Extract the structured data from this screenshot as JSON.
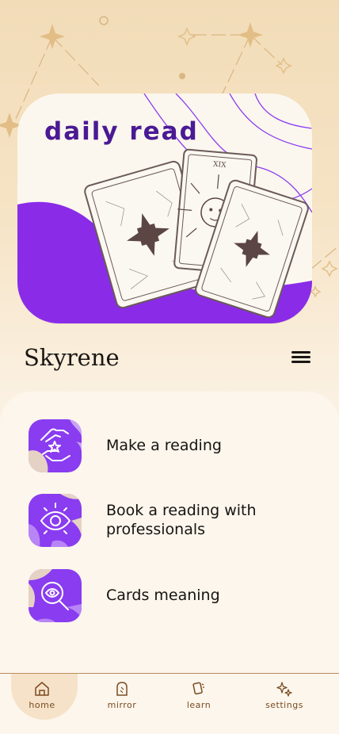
{
  "hero": {
    "title": "daily read"
  },
  "header": {
    "brand": "Skyrene"
  },
  "actions": [
    {
      "label": "Make a reading"
    },
    {
      "label": "Book a reading with professionals"
    },
    {
      "label": "Cards meaning"
    }
  ],
  "tabbar": {
    "active": "home",
    "items": [
      {
        "label": "home",
        "icon": "home-icon"
      },
      {
        "label": "mirror",
        "icon": "mirror-icon"
      },
      {
        "label": "learn",
        "icon": "cards-icon"
      },
      {
        "label": "settings",
        "icon": "sparkle-icon"
      }
    ]
  },
  "card_label": "XIX",
  "colors": {
    "accent": "#8a3cf0",
    "brand_text": "#4a1a94",
    "gold": "#c89b5a",
    "tab_text": "#7a4b21"
  }
}
